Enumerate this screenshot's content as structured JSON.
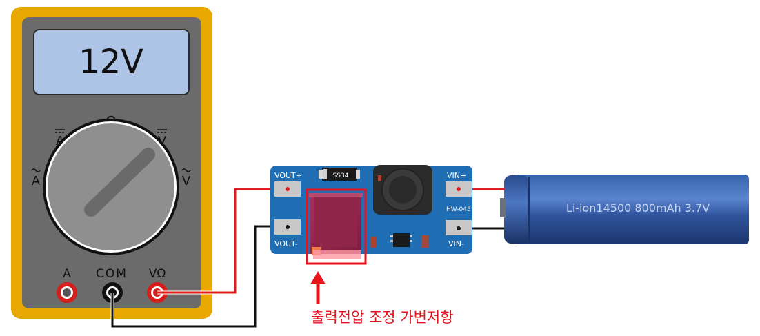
{
  "multimeter": {
    "display": "12V",
    "dial": {
      "ohm": "Ω",
      "dc_amp": "A",
      "dc_volt": "V",
      "ac_amp": "A",
      "ac_volt": "V"
    },
    "jacks": {
      "a": "A",
      "com": "COM",
      "vohm": "VΩ"
    }
  },
  "module": {
    "vout_plus": "VOUT+",
    "vout_minus": "VOUT-",
    "vin_plus": "VIN+",
    "vin_minus": "VIN-",
    "diode": "SS34",
    "model": "HW-045"
  },
  "battery": {
    "label": "Li-ion14500 800mAh 3.7V"
  },
  "annotation": {
    "text": "출력전압 조정 가변저항",
    "color": "#e8141c"
  },
  "colors": {
    "meter_frame": "#e8a800",
    "meter_body": "#6b6b6b",
    "lcd": "#aec4e6",
    "pcb": "#1f6db3",
    "battery": "#2c4f92",
    "wire_pos": "#e01c1c",
    "wire_neg": "#111111"
  }
}
